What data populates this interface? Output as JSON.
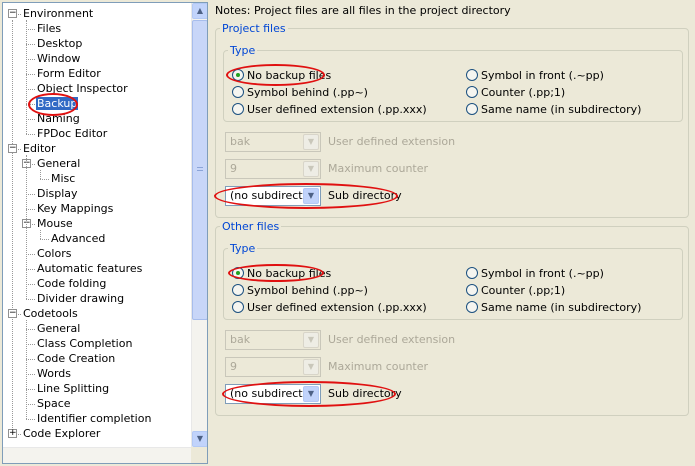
{
  "tree": {
    "items": [
      {
        "label": "Environment",
        "level": 0,
        "expander": "−"
      },
      {
        "label": "Files",
        "level": 1
      },
      {
        "label": "Desktop",
        "level": 1
      },
      {
        "label": "Window",
        "level": 1
      },
      {
        "label": "Form Editor",
        "level": 1
      },
      {
        "label": "Object Inspector",
        "level": 1
      },
      {
        "label": "Backup",
        "level": 1,
        "selected": true
      },
      {
        "label": "Naming",
        "level": 1
      },
      {
        "label": "FPDoc Editor",
        "level": 1
      },
      {
        "label": "Editor",
        "level": 0,
        "expander": "−"
      },
      {
        "label": "General",
        "level": 1,
        "expander": "−"
      },
      {
        "label": "Misc",
        "level": 2
      },
      {
        "label": "Display",
        "level": 1
      },
      {
        "label": "Key Mappings",
        "level": 1
      },
      {
        "label": "Mouse",
        "level": 1,
        "expander": "−"
      },
      {
        "label": "Advanced",
        "level": 2
      },
      {
        "label": "Colors",
        "level": 1
      },
      {
        "label": "Automatic features",
        "level": 1
      },
      {
        "label": "Code folding",
        "level": 1
      },
      {
        "label": "Divider drawing",
        "level": 1
      },
      {
        "label": "Codetools",
        "level": 0,
        "expander": "−"
      },
      {
        "label": "General",
        "level": 1
      },
      {
        "label": "Class Completion",
        "level": 1
      },
      {
        "label": "Code Creation",
        "level": 1
      },
      {
        "label": "Words",
        "level": 1
      },
      {
        "label": "Line Splitting",
        "level": 1
      },
      {
        "label": "Space",
        "level": 1
      },
      {
        "label": "Identifier completion",
        "level": 1
      },
      {
        "label": "Code Explorer",
        "level": 0,
        "expander": "+"
      }
    ]
  },
  "notes": "Notes: Project files are all files in the project directory",
  "project": {
    "title": "Project files",
    "type_title": "Type",
    "radios": [
      {
        "label": "No backup files",
        "checked": true
      },
      {
        "label": "Symbol behind (.pp~)",
        "checked": false
      },
      {
        "label": "User defined extension (.pp.xxx)",
        "checked": false
      },
      {
        "label": "Symbol in front (.~pp)",
        "checked": false
      },
      {
        "label": "Counter (.pp;1)",
        "checked": false
      },
      {
        "label": "Same name (in subdirectory)",
        "checked": false
      }
    ],
    "ext_value": "bak",
    "ext_label": "User defined extension",
    "counter_value": "9",
    "counter_label": "Maximum counter",
    "subdir_value": "(no subdirector",
    "subdir_label": "Sub directory"
  },
  "other": {
    "title": "Other files",
    "type_title": "Type",
    "radios": [
      {
        "label": "No backup files",
        "checked": true
      },
      {
        "label": "Symbol behind (.pp~)",
        "checked": false
      },
      {
        "label": "User defined extension (.pp.xxx)",
        "checked": false
      },
      {
        "label": "Symbol in front (.~pp)",
        "checked": false
      },
      {
        "label": "Counter (.pp;1)",
        "checked": false
      },
      {
        "label": "Same name (in subdirectory)",
        "checked": false
      }
    ],
    "ext_value": "bak",
    "ext_label": "User defined extension",
    "counter_value": "9",
    "counter_label": "Maximum counter",
    "subdir_value": "(no subdirector",
    "subdir_label": "Sub directory"
  },
  "icons": {
    "scroll_up": "scroll-up-arrow-icon",
    "scroll_down": "scroll-down-arrow-icon",
    "dropdown": "chevron-down-icon"
  },
  "colors": {
    "selection": "#316ac5",
    "annotation": "#e01010",
    "group_title": "#0046d5"
  }
}
